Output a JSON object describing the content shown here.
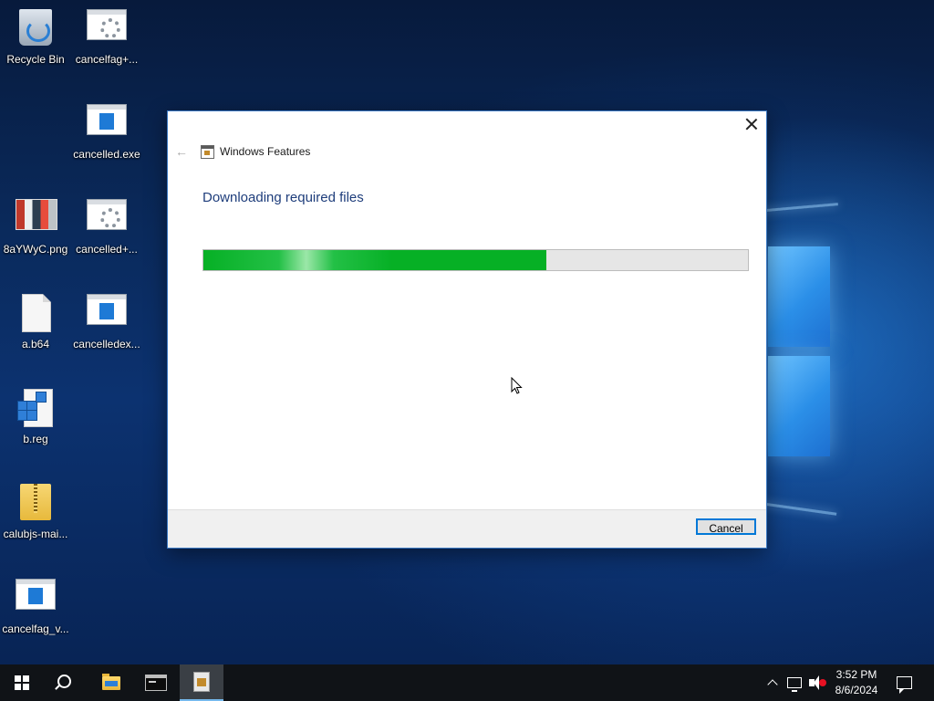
{
  "desktop": {
    "icons": [
      {
        "label": "Recycle Bin",
        "icon": "recycle-bin-icon"
      },
      {
        "label": "cancelfag+...",
        "icon": "settings-app-icon"
      },
      {
        "label": "cancelled.exe",
        "icon": "application-window-icon"
      },
      {
        "label": "8aYWyC.png",
        "icon": "image-thumbnail-icon"
      },
      {
        "label": "cancelled+...",
        "icon": "settings-app-icon"
      },
      {
        "label": "a.b64",
        "icon": "blank-file-icon"
      },
      {
        "label": "cancelledex...",
        "icon": "application-window-icon"
      },
      {
        "label": "b.reg",
        "icon": "registry-file-icon"
      },
      {
        "label": "calubjs-mai...",
        "icon": "zip-folder-icon"
      },
      {
        "label": "cancelfag_v...",
        "icon": "application-window-icon"
      }
    ]
  },
  "dialog": {
    "title": "Windows Features",
    "heading": "Downloading required files",
    "progress": 0.63,
    "cancel_label": "Cancel",
    "colors": {
      "accent": "#0078d7",
      "progress_green": "#06b025",
      "heading": "#1e3d7b"
    }
  },
  "taskbar": {
    "clock_time": "3:52 PM",
    "clock_date": "8/6/2024",
    "pinned": [
      "start-icon",
      "search-icon",
      "file-explorer-icon",
      "command-prompt-icon",
      "windows-features-icon"
    ]
  }
}
